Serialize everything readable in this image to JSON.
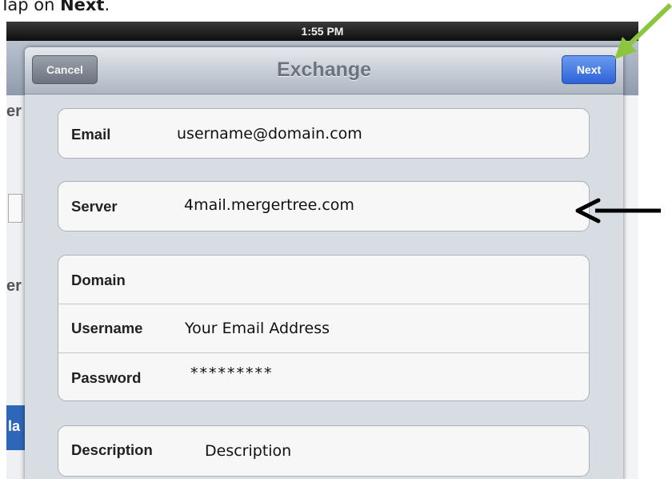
{
  "instruction": {
    "prefix": "Tap on ",
    "emphasis": "Next",
    "suffix": "."
  },
  "status_bar": {
    "time": "1:55 PM"
  },
  "background": {
    "fragments": [
      "er",
      "er",
      "la"
    ]
  },
  "navbar": {
    "title": "Exchange",
    "cancel_label": "Cancel",
    "next_label": "Next"
  },
  "fields": [
    {
      "label": "Email",
      "value": "username@domain.com"
    },
    {
      "label": "Server",
      "value": "4mail.mergertree.com"
    },
    {
      "label": "Domain",
      "value": ""
    },
    {
      "label": "Username",
      "value": "Your Email Address"
    },
    {
      "label": "Password",
      "value": "*********"
    },
    {
      "label": "Description",
      "value": "Description"
    }
  ],
  "annotations": {
    "green_arrow_color": "#8cc63f",
    "black_arrow_color": "#000000"
  }
}
